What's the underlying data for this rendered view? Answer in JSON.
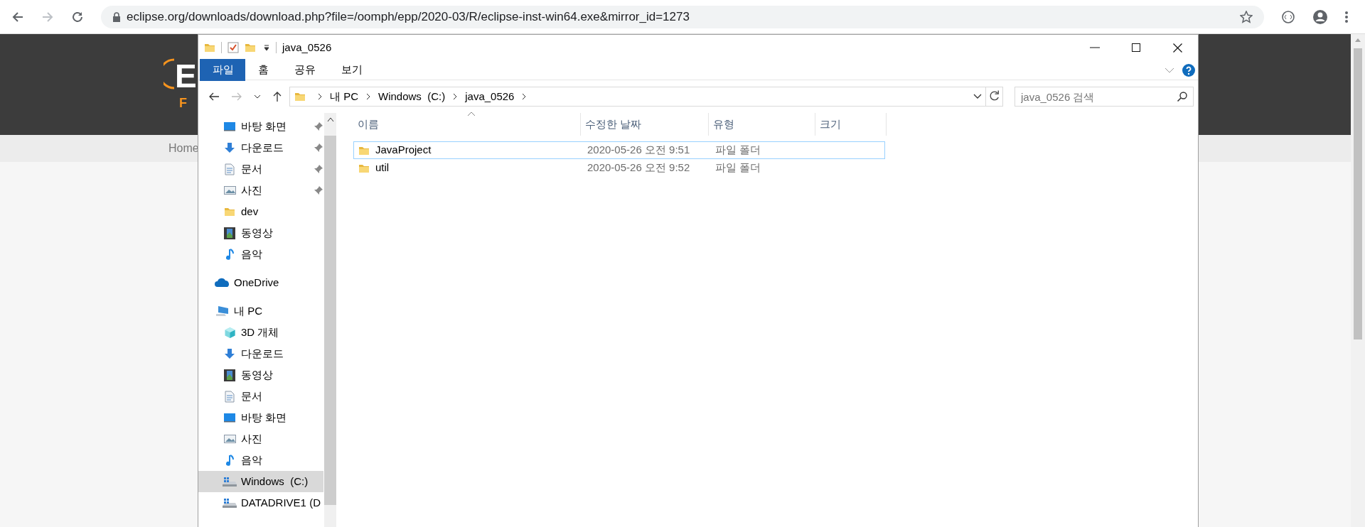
{
  "browser": {
    "url": "eclipse.org/downloads/download.php?file=/oomph/epp/2020-03/R/eclipse-inst-win64.exe&mirror_id=1273"
  },
  "web_page": {
    "logo_letter": "E",
    "logo_sub": "F",
    "nav_link": "Home"
  },
  "explorer": {
    "title": "java_0526",
    "ribbon_tabs": [
      {
        "label": "파일",
        "selected": true
      },
      {
        "label": "홈",
        "selected": false
      },
      {
        "label": "공유",
        "selected": false
      },
      {
        "label": "보기",
        "selected": false
      }
    ],
    "breadcrumb": [
      "내 PC",
      "Windows  (C:)",
      "java_0526"
    ],
    "search": {
      "placeholder": "java_0526 검색"
    },
    "nav_items": [
      {
        "label": "바탕 화면",
        "kind": "desktop",
        "pinned": true,
        "selected": false
      },
      {
        "label": "다운로드",
        "kind": "download",
        "pinned": true,
        "selected": false
      },
      {
        "label": "문서",
        "kind": "document",
        "pinned": true,
        "selected": false
      },
      {
        "label": "사진",
        "kind": "photo",
        "pinned": true,
        "selected": false
      },
      {
        "label": "dev",
        "kind": "folder",
        "pinned": false,
        "selected": false
      },
      {
        "label": "동영상",
        "kind": "video",
        "pinned": false,
        "selected": false
      },
      {
        "label": "음악",
        "kind": "music",
        "pinned": false,
        "selected": false
      },
      {
        "label": "OneDrive",
        "kind": "cloud",
        "pinned": false,
        "selected": false
      },
      {
        "label": "내 PC",
        "kind": "pc",
        "pinned": false,
        "selected": false,
        "children": [
          {
            "label": "3D 개체",
            "kind": "cube",
            "selected": false
          },
          {
            "label": "다운로드",
            "kind": "download",
            "selected": false
          },
          {
            "label": "동영상",
            "kind": "video",
            "selected": false
          },
          {
            "label": "문서",
            "kind": "document",
            "selected": false
          },
          {
            "label": "바탕 화면",
            "kind": "desktop",
            "selected": false
          },
          {
            "label": "사진",
            "kind": "photo",
            "selected": false
          },
          {
            "label": "음악",
            "kind": "music",
            "selected": false
          },
          {
            "label": "Windows  (C:)",
            "kind": "drive",
            "selected": true
          },
          {
            "label": "DATADRIVE1 (D",
            "kind": "drive",
            "selected": false
          }
        ]
      }
    ],
    "columns": [
      {
        "label": "이름",
        "sorted": true
      },
      {
        "label": "수정한 날짜",
        "sorted": false
      },
      {
        "label": "유형",
        "sorted": false
      },
      {
        "label": "크기",
        "sorted": false
      }
    ],
    "rows": [
      {
        "name": "JavaProject",
        "modified": "2020-05-26 오전 9:51",
        "type": "파일 폴더",
        "focused": true
      },
      {
        "name": "util",
        "modified": "2020-05-26 오전 9:52",
        "type": "파일 폴더",
        "focused": false
      }
    ]
  }
}
